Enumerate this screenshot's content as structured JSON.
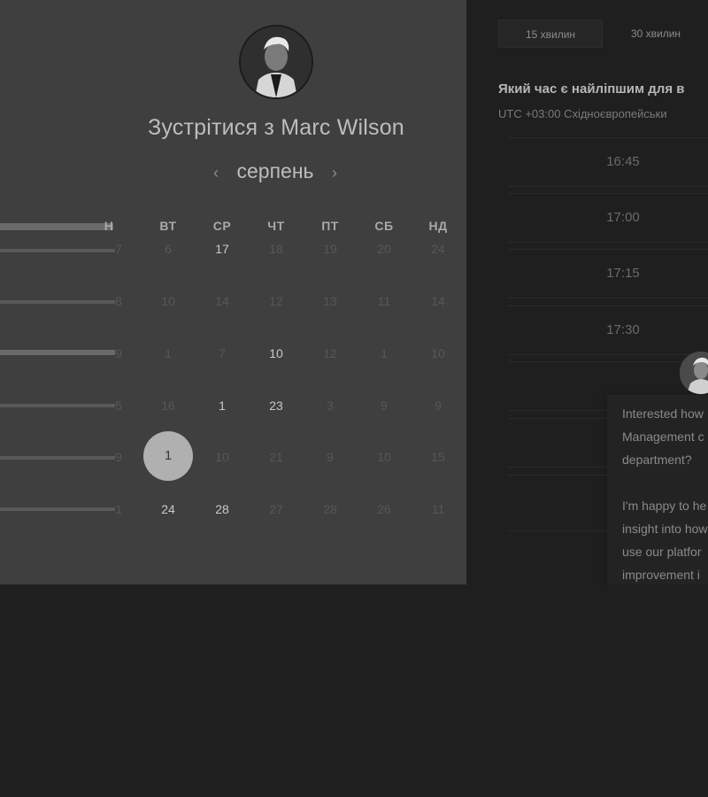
{
  "host": {
    "meet_title": "Зустрітися з Marc Wilson",
    "avatar_icon": "host-avatar-icon"
  },
  "calendar": {
    "month": "серпень",
    "prev_icon": "chevron-left-icon",
    "next_icon": "chevron-right-icon",
    "weekdays": [
      "Н",
      "ВТ",
      "СР",
      "ЧТ",
      "ПТ",
      "СБ",
      "НД"
    ],
    "rows": [
      [
        "7",
        "6",
        "17",
        "18",
        "19",
        "20",
        "24"
      ],
      [
        "8",
        "10",
        "14",
        "12",
        "13",
        "11",
        "14"
      ],
      [
        "9",
        "1",
        "7",
        "10",
        "12",
        "1",
        "10"
      ],
      [
        "5",
        "16",
        "1",
        "23",
        "3",
        "9",
        "9"
      ],
      [
        "9",
        "1",
        "10",
        "21",
        "9",
        "10",
        "15"
      ],
      [
        "1",
        "24",
        "28",
        "27",
        "28",
        "26",
        "11"
      ]
    ],
    "selected_day": "1"
  },
  "durations": [
    "15 хвилин",
    "30 хвилин"
  ],
  "time_question": "Який час є найліпшим для в",
  "timezone": "UTC +03:00 Східноєвропейськи",
  "time_slots": [
    "16:45",
    "17:00",
    "17:15",
    "17:30",
    "",
    "",
    ""
  ],
  "chat": {
    "avatar_icon": "chat-agent-avatar-icon",
    "message": "Interested how\nManagement c\ndepartment?\n\nI'm happy to he\ninsight into how\nuse our platfor\nimprovement i\nproductivity."
  },
  "colors": {
    "panel_bg": "#3f3f3f",
    "page_bg": "#1f1f1f",
    "selected_day_bg": "#b0b0b0"
  }
}
